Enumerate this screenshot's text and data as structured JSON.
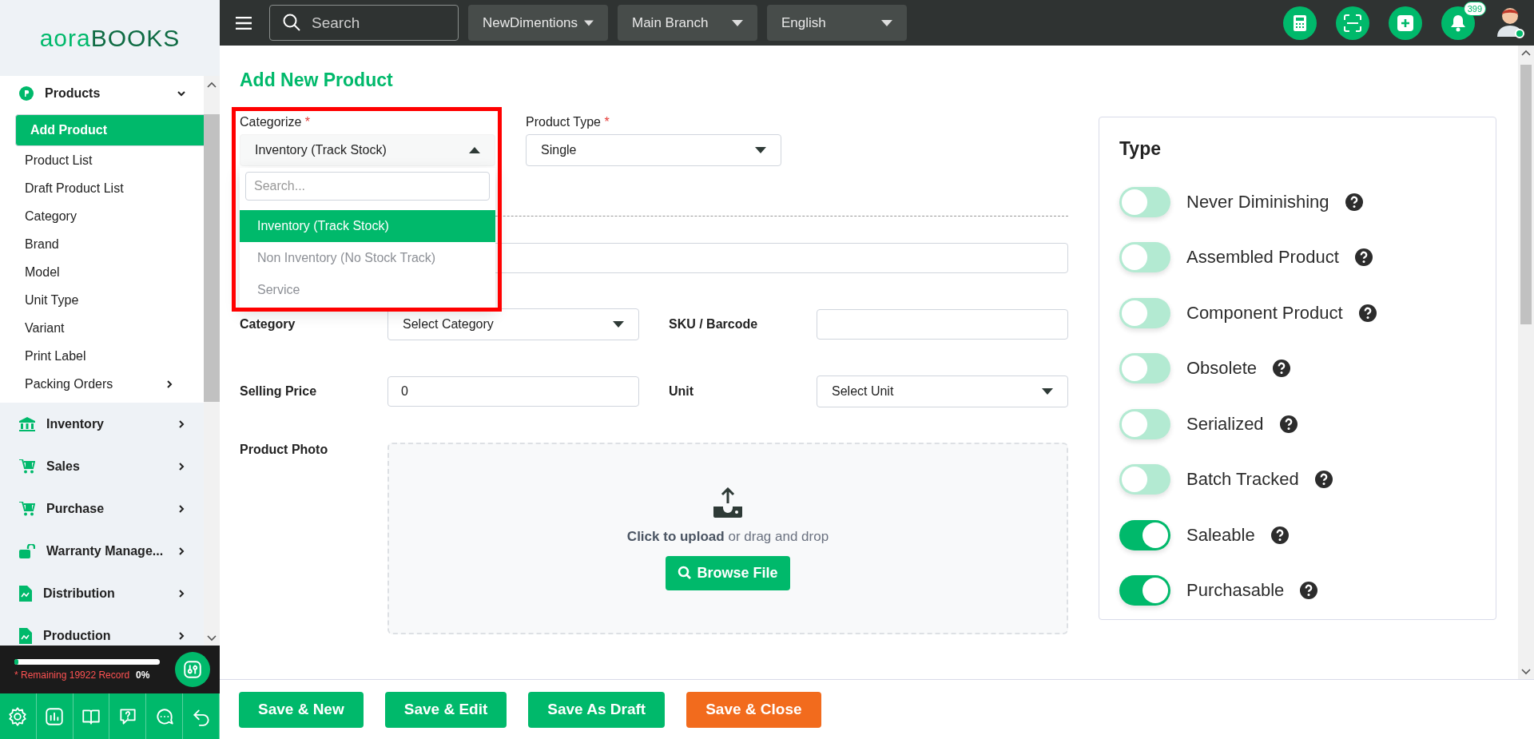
{
  "logo": {
    "part_1": "aora",
    "part_2": "BOOKS"
  },
  "sidebar": {
    "items": [
      {
        "label": "Products",
        "expanded": true,
        "children": [
          {
            "label": "Add Product",
            "selected": true,
            "kind": "link"
          },
          {
            "label": "Product List",
            "selected": false,
            "kind": "link"
          },
          {
            "label": "Draft Product List",
            "selected": false,
            "kind": "link"
          },
          {
            "label": "Category",
            "selected": false,
            "kind": "link"
          },
          {
            "label": "Brand",
            "selected": false,
            "kind": "link"
          },
          {
            "label": "Model",
            "selected": false,
            "kind": "link"
          },
          {
            "label": "Unit Type",
            "selected": false,
            "kind": "link"
          },
          {
            "label": "Variant",
            "selected": false,
            "kind": "link"
          },
          {
            "label": "Print Label",
            "selected": false,
            "kind": "link"
          },
          {
            "label": "Packing Orders",
            "selected": false,
            "kind": "group"
          }
        ]
      },
      {
        "label": "Inventory",
        "expanded": false
      },
      {
        "label": "Sales",
        "expanded": false
      },
      {
        "label": "Purchase",
        "expanded": false
      },
      {
        "label": "Warranty Manage...",
        "expanded": false
      },
      {
        "label": "Distribution",
        "expanded": false
      },
      {
        "label": "Production",
        "expanded": false
      }
    ],
    "usage": {
      "level": 0.03,
      "remaining": "* Remaining 19922 Record",
      "percent": "0%"
    }
  },
  "topbar": {
    "search": {
      "placeholder": "Search"
    },
    "selects": [
      "NewDimentions",
      "Main Branch",
      "English"
    ],
    "notification_count": "399"
  },
  "page": {
    "title": "Add New Product",
    "categorize": {
      "label": "Categorize",
      "required_mark": "*",
      "value": "Inventory (Track Stock)",
      "open": true,
      "highlighted": true,
      "search_placeholder": "Search...",
      "options": [
        {
          "label": "Inventory (Track Stock)",
          "selected": true
        },
        {
          "label": "Non Inventory (No Stock Track)",
          "selected": false
        },
        {
          "label": "Service",
          "selected": false
        }
      ]
    },
    "product_type": {
      "label": "Product Type",
      "required_mark": "*",
      "value": "Single"
    },
    "rows": [
      [
        {
          "kind": "text"
        }
      ],
      [
        {
          "kind": "select",
          "label": "Category",
          "value": "Select Category"
        },
        {
          "kind": "text",
          "label": "SKU / Barcode"
        }
      ],
      [
        {
          "kind": "text",
          "label": "Selling Price",
          "value": "0"
        },
        {
          "kind": "select",
          "label": "Unit",
          "value": "Select Unit"
        }
      ]
    ],
    "photo": {
      "label": "Product Photo",
      "hint": "**Click to upload** or drag and drop",
      "button": "Browse File"
    },
    "type_panel": {
      "title": "Type",
      "toggles": [
        {
          "label": "Never Diminishing",
          "on": false
        },
        {
          "label": "Assembled Product",
          "on": false
        },
        {
          "label": "Component Product",
          "on": false
        },
        {
          "label": "Obsolete",
          "on": false
        },
        {
          "label": "Serialized",
          "on": false
        },
        {
          "label": "Batch Tracked",
          "on": false
        },
        {
          "label": "Saleable",
          "on": true
        },
        {
          "label": "Purchasable",
          "on": true
        }
      ]
    }
  },
  "footer": {
    "buttons": [
      {
        "label": "Save & New",
        "kind": "primary"
      },
      {
        "label": "Save & Edit",
        "kind": "primary"
      },
      {
        "label": "Save As Draft",
        "kind": "primary"
      },
      {
        "label": "Save & Close",
        "kind": "accent"
      }
    ]
  }
}
